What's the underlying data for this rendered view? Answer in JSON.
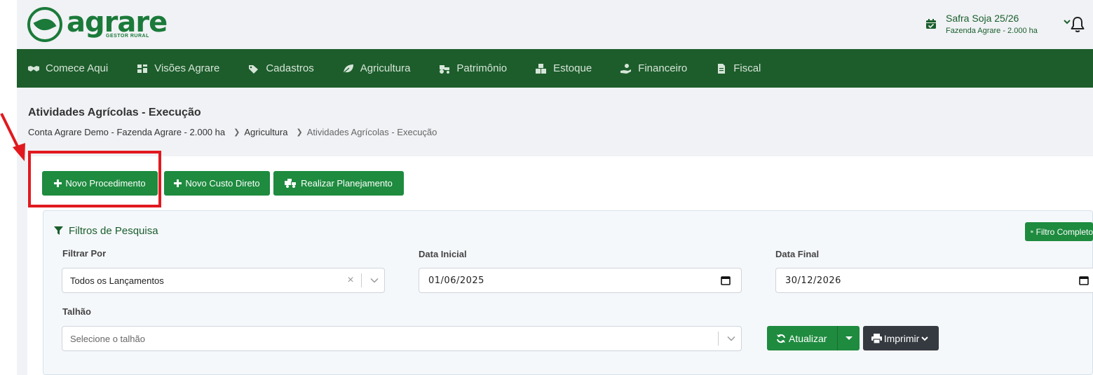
{
  "header": {
    "logo_name": "agrare",
    "logo_sub": "GESTOR RURAL",
    "season_title": "Safra Soja 25/26",
    "season_farm": "Fazenda Agrare - 2.000 ha"
  },
  "nav": {
    "items": [
      {
        "label": "Comece Aqui",
        "icon": "handshake-icon"
      },
      {
        "label": "Visões Agrare",
        "icon": "dashboard-icon"
      },
      {
        "label": "Cadastros",
        "icon": "tags-icon"
      },
      {
        "label": "Agricultura",
        "icon": "leaf-icon"
      },
      {
        "label": "Patrimônio",
        "icon": "tractor-icon"
      },
      {
        "label": "Estoque",
        "icon": "boxes-icon"
      },
      {
        "label": "Financeiro",
        "icon": "hand-coin-icon"
      },
      {
        "label": "Fiscal",
        "icon": "invoice-icon"
      }
    ]
  },
  "page": {
    "title": "Atividades Agrícolas - Execução",
    "breadcrumb": [
      "Conta Agrare Demo - Fazenda Agrare - 2.000 ha",
      "Agricultura",
      "Atividades Agrícolas - Execução"
    ]
  },
  "actions": {
    "novo_procedimento": "Novo Procedimento",
    "novo_custo_direto": "Novo Custo Direto",
    "realizar_planejamento": "Realizar Planejamento"
  },
  "filters": {
    "title": "Filtros de Pesquisa",
    "filtro_completo": "Filtro Completo",
    "filtrar_por_label": "Filtrar Por",
    "filtrar_por_value": "Todos os Lançamentos",
    "data_inicial_label": "Data Inicial",
    "data_inicial_value": "01/06/2025",
    "data_final_label": "Data Final",
    "data_final_value": "30/12/2026",
    "talhao_label": "Talhão",
    "talhao_placeholder": "Selecione o talhão",
    "atualizar": "Atualizar",
    "imprimir": "Imprimir"
  },
  "colors": {
    "brand_green": "#1b7a3a",
    "nav_green": "#1d5d2b",
    "button_green": "#1e8b3f",
    "dark_button": "#343a40",
    "highlight_red": "#e1191f"
  }
}
